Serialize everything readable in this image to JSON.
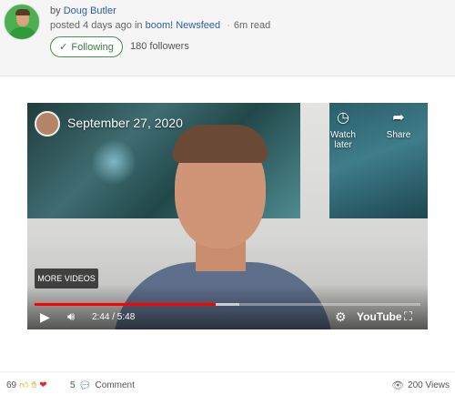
{
  "author": {
    "by_prefix": "by",
    "name": "Doug Butler",
    "posted_prefix": "posted",
    "time_ago": "4 days ago",
    "in_word": "in",
    "group": "boom! Newsfeed",
    "separator": "·",
    "read_time": "6m read",
    "follow_label": "Following",
    "followers": "180 followers"
  },
  "video": {
    "title": "September 27, 2020",
    "watch_later": "Watch later",
    "share": "Share",
    "more_videos": "MORE VIDEOS",
    "time": "2:44 / 5:48",
    "played_fraction": 0.47,
    "buffered_fraction": 0.53,
    "brand": "YouTube"
  },
  "footer": {
    "reaction_count": "69",
    "comment_count": "5",
    "comment_label": "Comment",
    "views": "200 Views"
  },
  "colors": {
    "link": "#2d5ea8",
    "follow_green": "#3c7d41",
    "progress_red": "#ff0000"
  },
  "icons": [
    "check-icon",
    "clock-icon",
    "share-icon",
    "play-icon",
    "volume-icon",
    "settings-icon",
    "fullscreen-icon",
    "thumbs-up-icon",
    "clap-icon",
    "heart-icon",
    "comment-bubble-icon",
    "eye-icon"
  ]
}
